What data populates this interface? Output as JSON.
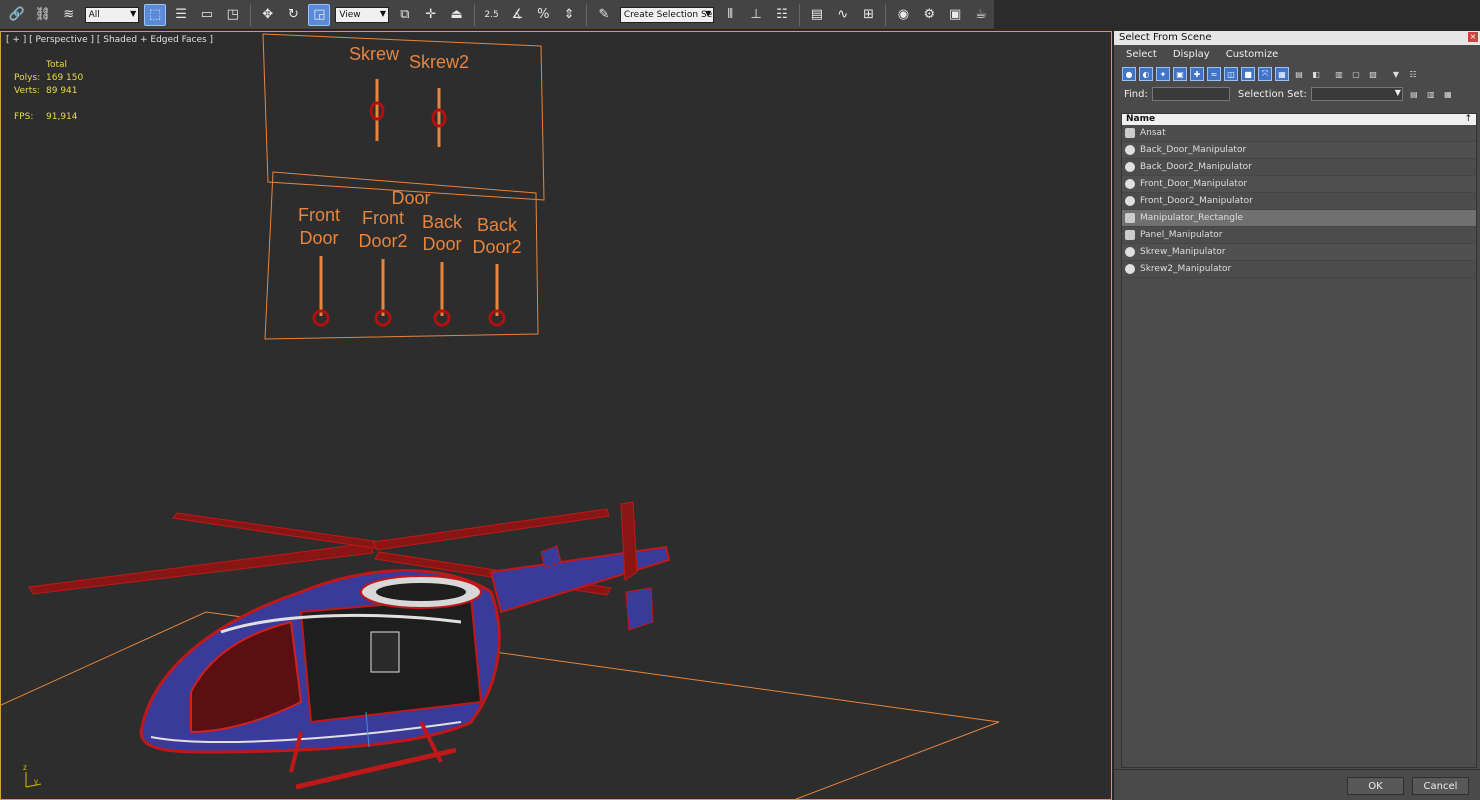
{
  "toolbar": {
    "filter_value": "All",
    "refcoord_value": "View",
    "snap_label": "2.5",
    "named_selection_placeholder": "Create Selection Se",
    "colors": {
      "bg": "#444444",
      "active": "#5a8ad8"
    }
  },
  "viewport": {
    "label": "[ + ] [ Perspective ] [ Shaded + Edged Faces ]",
    "stats": {
      "total_label": "Total",
      "polys_label": "Polys:",
      "polys_value": "169 150",
      "verts_label": "Verts:",
      "verts_value": "89 941",
      "fps_label": "FPS:",
      "fps_value": "91,914"
    },
    "panel_top": {
      "label1": "Skrew",
      "label2": "Skrew2"
    },
    "panel_bottom": {
      "title": "Door",
      "s1a": "Front",
      "s1b": "Door",
      "s2a": "Front",
      "s2b": "Door2",
      "s3a": "Back",
      "s3b": "Door",
      "s4a": "Back",
      "s4b": "Door2"
    },
    "axis_y": "y",
    "axis_z": "z",
    "colors": {
      "wire": "#e8843c",
      "heli": "#c01818",
      "body": "#3a3a9a",
      "border": "#d6a033"
    }
  },
  "dialog": {
    "title": "Select From Scene",
    "close_glyph": "×",
    "menu": {
      "select": "Select",
      "display": "Display",
      "customize": "Customize"
    },
    "find_label": "Find:",
    "selection_set_label": "Selection Set:",
    "column_name": "Name",
    "sort_glyph": "↑",
    "items": [
      "Ansat",
      "Back_Door_Manipulator",
      "Back_Door2_Manipulator",
      "Front_Door_Manipulator",
      "Front_Door2_Manipulator",
      "Manipulator_Rectangle",
      "Panel_Manipulator",
      "Skrew_Manipulator",
      "Skrew2_Manipulator"
    ],
    "selected_index": 5,
    "ok_label": "OK",
    "cancel_label": "Cancel"
  }
}
